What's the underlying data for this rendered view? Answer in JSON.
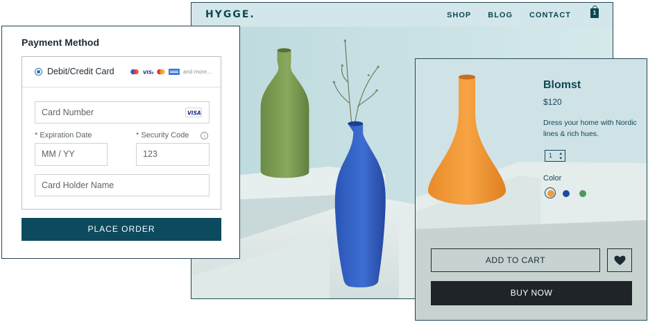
{
  "store": {
    "brand": "HYGGE.",
    "nav": [
      "SHOP",
      "BLOG",
      "CONTACT"
    ],
    "cart_count": "1"
  },
  "payment": {
    "title": "Payment Method",
    "method_label": "Debit/Credit Card",
    "card_icons": [
      "maestro-icon",
      "visa-icon",
      "mastercard-icon",
      "amex-icon"
    ],
    "more_text": "and more...",
    "card_number_placeholder": "Card Number",
    "card_brand_badge": "VISA",
    "expiration_label": "* Expiration Date",
    "expiration_placeholder": "MM / YY",
    "security_label": "* Security Code",
    "security_placeholder": "123",
    "holder_placeholder": "Card Holder Name",
    "place_order": "PLACE ORDER"
  },
  "product": {
    "name": "Blomst",
    "price": "$120",
    "description": "Dress your home with Nordic lines & rich hues.",
    "quantity": "1",
    "color_label": "Color",
    "colors": [
      "#f09a3b",
      "#1c4aa3",
      "#4e9a5c"
    ],
    "selected_color": 0,
    "add_to_cart": "ADD TO CART",
    "buy_now": "BUY NOW"
  },
  "colors": {
    "accent": "#0d4a5e",
    "buy_button": "#1f2428",
    "background_blue": "#cfe3e6"
  }
}
